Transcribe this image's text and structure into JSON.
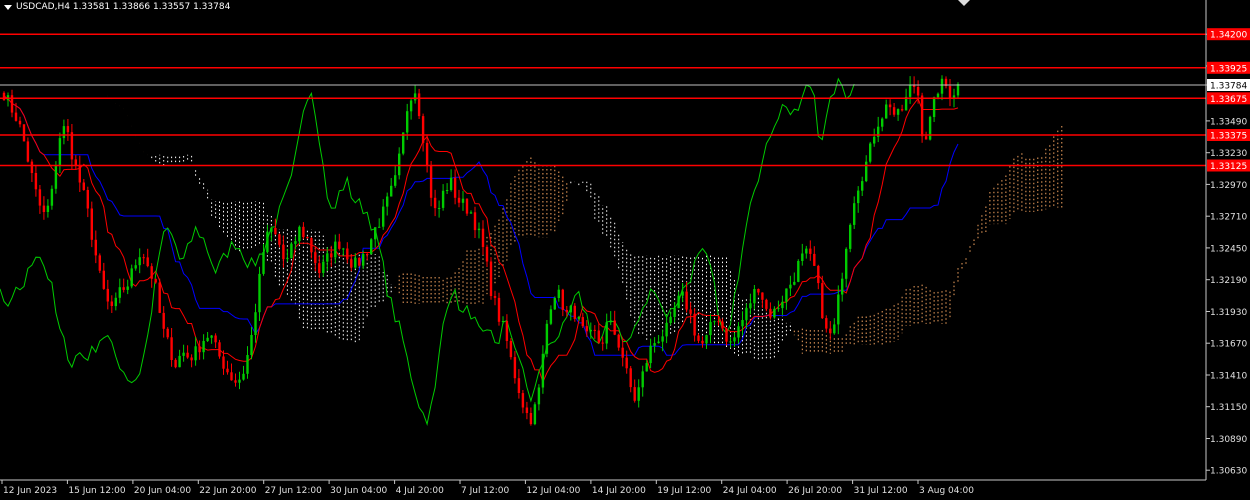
{
  "header": {
    "symbol": "USDCAD,H4",
    "ohlc": "1.33581 1.33866 1.33557 1.33784"
  },
  "chart_data": {
    "type": "candlestick",
    "symbol": "USDCAD",
    "timeframe": "H4",
    "ylim": [
      1.3055,
      1.3448
    ],
    "y_ticks": [
      "1.34200",
      "1.33940",
      "1.33784",
      "1.33490",
      "1.33230",
      "1.32970",
      "1.32710",
      "1.32450",
      "1.32190",
      "1.31930",
      "1.31670",
      "1.31410",
      "1.31150",
      "1.30890",
      "1.30630"
    ],
    "x_ticks": [
      "12 Jun 2023",
      "15 Jun 12:00",
      "20 Jun 04:00",
      "22 Jun 20:00",
      "27 Jun 12:00",
      "30 Jun 04:00",
      "4 Jul 20:00",
      "7 Jul 12:00",
      "12 Jul 04:00",
      "14 Jul 20:00",
      "19 Jul 12:00",
      "24 Jul 04:00",
      "26 Jul 20:00",
      "31 Jul 12:00",
      "3 Aug 04:00"
    ],
    "horizontal_levels": [
      {
        "label": "1.34200",
        "value": 1.342,
        "color": "#ff0000"
      },
      {
        "label": "1.33925",
        "value": 1.33925,
        "color": "#ff0000"
      },
      {
        "label": "1.33675",
        "value": 1.33675,
        "color": "#ff0000"
      },
      {
        "label": "1.33375",
        "value": 1.33375,
        "color": "#ff0000"
      },
      {
        "label": "1.33125",
        "value": 1.33125,
        "color": "#ff0000"
      }
    ],
    "current_price": {
      "label": "1.33784",
      "value": 1.33784
    },
    "colors": {
      "bull": "#00cc00",
      "bear": "#ff0000",
      "tenkan": "#ff0000",
      "kijun": "#0000ff",
      "chikou": "#00cc00",
      "cloud_bear": "#ffffff",
      "cloud_bull": "#f4a460"
    },
    "trend_points": [
      1.3372,
      1.336,
      1.335,
      1.333,
      1.3305,
      1.3282,
      1.327,
      1.329,
      1.3335,
      1.3345,
      1.332,
      1.33,
      1.328,
      1.325,
      1.322,
      1.32,
      1.3195,
      1.321,
      1.3215,
      1.323,
      1.3245,
      1.323,
      1.3215,
      1.318,
      1.3165,
      1.315,
      1.316,
      1.3155,
      1.316,
      1.317,
      1.3175,
      1.316,
      1.315,
      1.314,
      1.3135,
      1.3145,
      1.317,
      1.321,
      1.325,
      1.326,
      1.325,
      1.323,
      1.3245,
      1.326,
      1.3255,
      1.324,
      1.3225,
      1.3235,
      1.3245,
      1.325,
      1.324,
      1.323,
      1.3235,
      1.3245,
      1.326,
      1.327,
      1.3285,
      1.33,
      1.333,
      1.337,
      1.3375,
      1.334,
      1.3295,
      1.327,
      1.329,
      1.33,
      1.3285,
      1.328,
      1.3275,
      1.326,
      1.324,
      1.321,
      1.319,
      1.3175,
      1.315,
      1.313,
      1.311,
      1.3105,
      1.313,
      1.318,
      1.321,
      1.3205,
      1.319,
      1.3195,
      1.318,
      1.317,
      1.3175,
      1.3165,
      1.3185,
      1.3175,
      1.316,
      1.3135,
      1.312,
      1.314,
      1.316,
      1.317,
      1.3175,
      1.318,
      1.32,
      1.3205,
      1.319,
      1.317,
      1.3165,
      1.318,
      1.319,
      1.3175,
      1.3165,
      1.318,
      1.319,
      1.3205,
      1.3215,
      1.3195,
      1.319,
      1.32,
      1.321,
      1.322,
      1.3235,
      1.324,
      1.323,
      1.32,
      1.317,
      1.318,
      1.322,
      1.326,
      1.329,
      1.3305,
      1.332,
      1.3345,
      1.3355,
      1.3365,
      1.335,
      1.336,
      1.3375,
      1.338,
      1.333,
      1.335,
      1.3375,
      1.338,
      1.337,
      1.3378
    ]
  }
}
